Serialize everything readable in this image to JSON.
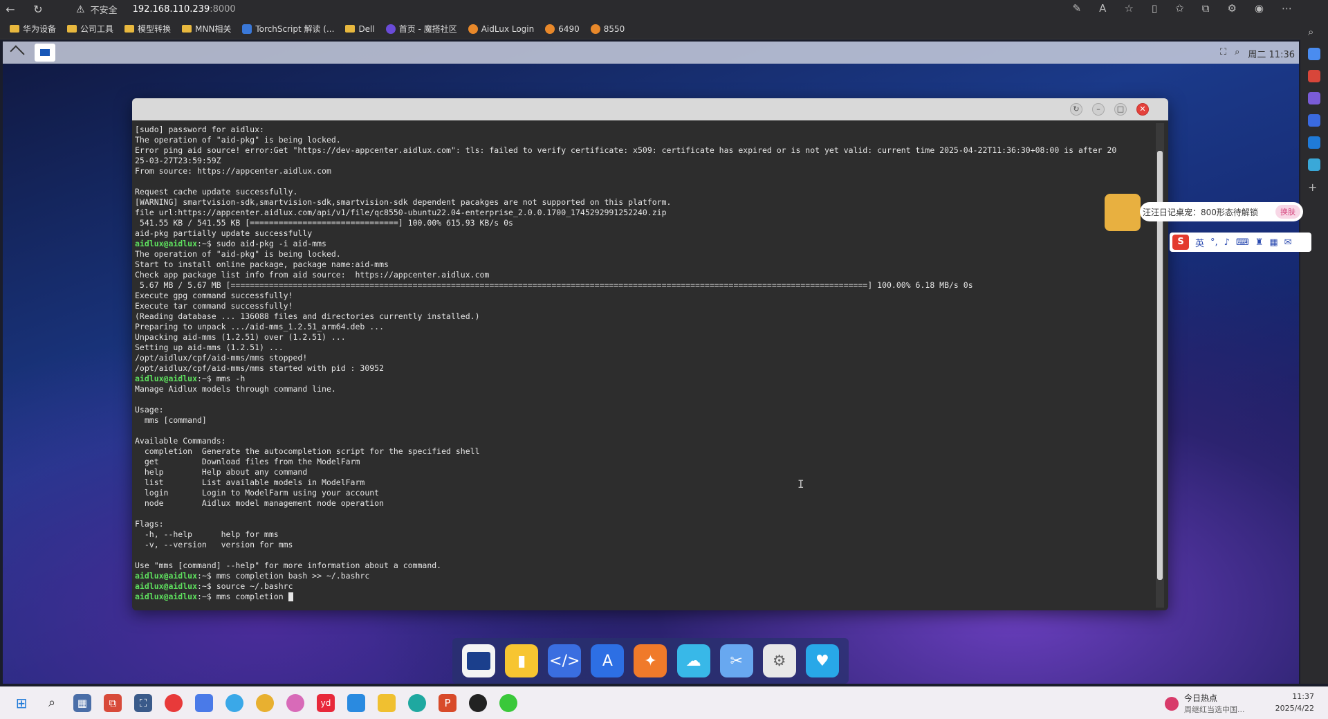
{
  "browser": {
    "security_label": "不安全",
    "address": "192.168.110.239",
    "port": ":8000",
    "bookmarks": [
      "华为设备",
      "公司工具",
      "模型转换",
      "MNN相关",
      "TorchScript 解读 (...",
      "Dell",
      "首页 - 魔搭社区",
      "AidLux Login",
      "6490",
      "8550"
    ]
  },
  "desktop": {
    "clock": "周二 11:36"
  },
  "terminal": {
    "lines": [
      {
        "prompt": "",
        "text": "[sudo] password for aidlux:"
      },
      {
        "prompt": "",
        "text": "The operation of \"aid-pkg\" is being locked."
      },
      {
        "prompt": "",
        "text": "Error ping aid source! error:Get \"https://dev-appcenter.aidlux.com\": tls: failed to verify certificate: x509: certificate has expired or is not yet valid: current time 2025-04-22T11:36:30+08:00 is after 20"
      },
      {
        "prompt": "",
        "text": "25-03-27T23:59:59Z"
      },
      {
        "prompt": "",
        "text": "From source: https://appcenter.aidlux.com"
      },
      {
        "prompt": "",
        "text": ""
      },
      {
        "prompt": "",
        "text": "Request cache update successfully."
      },
      {
        "prompt": "",
        "text": "[WARNING] smartvision-sdk,smartvision-sdk,smartvision-sdk dependent pacakges are not supported on this platform."
      },
      {
        "prompt": "",
        "text": "file url:https://appcenter.aidlux.com/api/v1/file/qc8550-ubuntu22.04-enterprise_2.0.0.1700_1745292991252240.zip"
      },
      {
        "prompt": "",
        "text": " 541.55 KB / 541.55 KB [===============================] 100.00% 615.93 KB/s 0s"
      },
      {
        "prompt": "",
        "text": "aid-pkg partially update successfully"
      },
      {
        "prompt": "aidlux@aidlux",
        "text": ":~$ sudo aid-pkg -i aid-mms"
      },
      {
        "prompt": "",
        "text": "The operation of \"aid-pkg\" is being locked."
      },
      {
        "prompt": "",
        "text": "Start to install online package, package name:aid-mms"
      },
      {
        "prompt": "",
        "text": "Check app package list info from aid source:  https://appcenter.aidlux.com"
      },
      {
        "prompt": "",
        "text": " 5.67 MB / 5.67 MB [=====================================================================================================================================] 100.00% 6.18 MB/s 0s"
      },
      {
        "prompt": "",
        "text": "Execute gpg command successfully!"
      },
      {
        "prompt": "",
        "text": "Execute tar command successfully!"
      },
      {
        "prompt": "",
        "text": "(Reading database ... 136088 files and directories currently installed.)"
      },
      {
        "prompt": "",
        "text": "Preparing to unpack .../aid-mms_1.2.51_arm64.deb ..."
      },
      {
        "prompt": "",
        "text": "Unpacking aid-mms (1.2.51) over (1.2.51) ..."
      },
      {
        "prompt": "",
        "text": "Setting up aid-mms (1.2.51) ..."
      },
      {
        "prompt": "",
        "text": "/opt/aidlux/cpf/aid-mms/mms stopped!"
      },
      {
        "prompt": "",
        "text": "/opt/aidlux/cpf/aid-mms/mms started with pid : 30952"
      },
      {
        "prompt": "aidlux@aidlux",
        "text": ":~$ mms -h"
      },
      {
        "prompt": "",
        "text": "Manage Aidlux models through command line."
      },
      {
        "prompt": "",
        "text": ""
      },
      {
        "prompt": "",
        "text": "Usage:"
      },
      {
        "prompt": "",
        "text": "  mms [command]"
      },
      {
        "prompt": "",
        "text": ""
      },
      {
        "prompt": "",
        "text": "Available Commands:"
      },
      {
        "prompt": "",
        "text": "  completion  Generate the autocompletion script for the specified shell"
      },
      {
        "prompt": "",
        "text": "  get         Download files from the ModelFarm"
      },
      {
        "prompt": "",
        "text": "  help        Help about any command"
      },
      {
        "prompt": "",
        "text": "  list        List available models in ModelFarm"
      },
      {
        "prompt": "",
        "text": "  login       Login to ModelFarm using your account"
      },
      {
        "prompt": "",
        "text": "  node        Aidlux model management node operation"
      },
      {
        "prompt": "",
        "text": ""
      },
      {
        "prompt": "",
        "text": "Flags:"
      },
      {
        "prompt": "",
        "text": "  -h, --help      help for mms"
      },
      {
        "prompt": "",
        "text": "  -v, --version   version for mms"
      },
      {
        "prompt": "",
        "text": ""
      },
      {
        "prompt": "",
        "text": "Use \"mms [command] --help\" for more information about a command."
      },
      {
        "prompt": "aidlux@aidlux",
        "text": ":~$ mms completion bash >> ~/.bashrc"
      },
      {
        "prompt": "aidlux@aidlux",
        "text": ":~$ source ~/.bashrc"
      },
      {
        "prompt": "aidlux@aidlux",
        "text": ":~$ mms completion "
      }
    ]
  },
  "pet": {
    "banner": "汪汪日记桌宠：800形态待解锁",
    "skin_button": "换肤"
  },
  "ime": {
    "logo": "S",
    "lang": "英"
  },
  "dock": {
    "items": [
      "terminal",
      "files",
      "code",
      "app-store",
      "ideas",
      "cloud",
      "tools",
      "settings",
      "heart-app"
    ]
  },
  "taskbar": {
    "news_title": "今日热点",
    "news_sub": "周继红当选中国...",
    "time": "11:37",
    "date": "2025/4/22"
  }
}
